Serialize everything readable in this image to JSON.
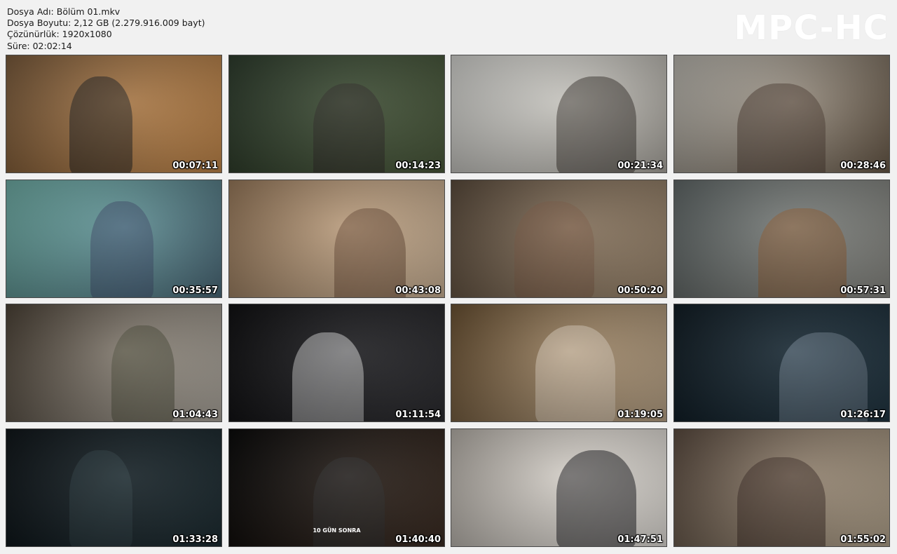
{
  "file_info": {
    "name_line": "Dosya Adı: Bölüm 01.mkv",
    "size_line": "Dosya Boyutu: 2,12 GB (2.279.916.009 bayt)",
    "resolution_line": "Çözünürlük: 1920x1080",
    "duration_line": "Süre: 02:02:14"
  },
  "brand": "MPC-HC",
  "thumbnails": [
    {
      "time": "00:07:11",
      "bg": "#7a5a3a",
      "bg2": "#c88a4a",
      "fig": "#1c1c1c"
    },
    {
      "time": "00:14:23",
      "bg": "#2b3a2a",
      "bg2": "#4a5a3a",
      "fig": "#2a2622"
    },
    {
      "time": "00:21:34",
      "bg": "#d8d8d4",
      "bg2": "#b0aca4",
      "fig": "#3a3430"
    },
    {
      "time": "00:28:46",
      "bg": "#bdbab2",
      "bg2": "#6a5a48",
      "fig": "#4a3a30"
    },
    {
      "time": "00:35:57",
      "bg": "#6fb0a8",
      "bg2": "#4a6a7a",
      "fig": "#3a4a6a"
    },
    {
      "time": "00:43:08",
      "bg": "#9a7a5a",
      "bg2": "#d2b89a",
      "fig": "#6a4a34"
    },
    {
      "time": "00:50:20",
      "bg": "#5a4a3a",
      "bg2": "#a08a70",
      "fig": "#7a5a44"
    },
    {
      "time": "00:57:31",
      "bg": "#606868",
      "bg2": "#8a8a84",
      "fig": "#8a5a30"
    },
    {
      "time": "01:04:43",
      "bg": "#4a4034",
      "bg2": "#b0aaa0",
      "fig": "#4a4a38"
    },
    {
      "time": "01:11:54",
      "bg": "#0c0c0e",
      "bg2": "#2a2a2e",
      "fig": "#c8c8c8"
    },
    {
      "time": "01:19:05",
      "bg": "#6a5030",
      "bg2": "#bfa88a",
      "fig": "#d8cab8"
    },
    {
      "time": "01:26:17",
      "bg": "#0e1a22",
      "bg2": "#1e3340",
      "fig": "#6a7a88"
    },
    {
      "time": "01:33:28",
      "bg": "#0c1216",
      "bg2": "#1a2a30",
      "fig": "#2a3a40"
    },
    {
      "time": "01:40:40",
      "bg": "#060606",
      "bg2": "#3a2a20",
      "fig": "#2a2a2a",
      "caption": "10 GÜN SONRA"
    },
    {
      "time": "01:47:51",
      "bg": "#bab4ac",
      "bg2": "#e8e4de",
      "fig": "#1a1a1e"
    },
    {
      "time": "01:55:02",
      "bg": "#5a4a3e",
      "bg2": "#b8a890",
      "fig": "#3a2a22"
    }
  ]
}
